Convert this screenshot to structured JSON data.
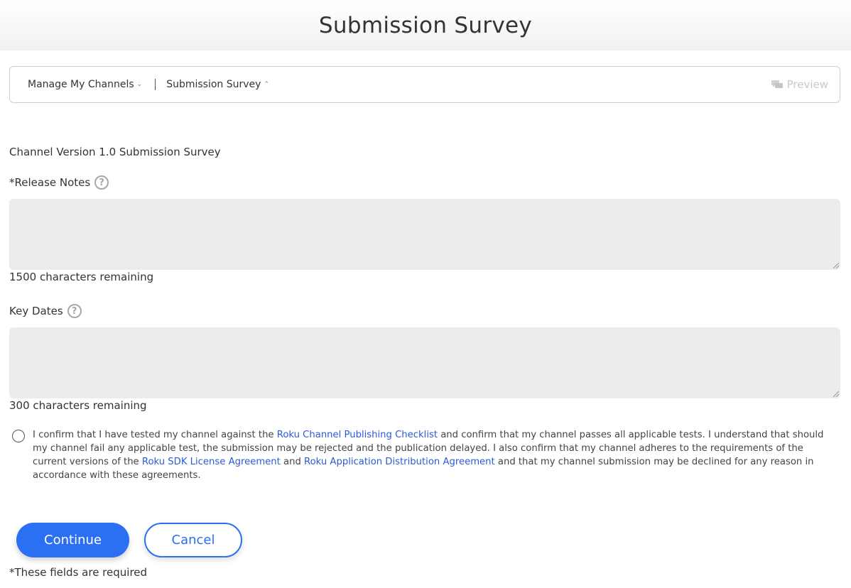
{
  "header": {
    "title": "Submission Survey"
  },
  "nav": {
    "crumbs": [
      {
        "label": "Manage My Channels"
      },
      {
        "label": "Submission Survey"
      }
    ],
    "preview_label": "Preview"
  },
  "form": {
    "section_title": "Channel Version 1.0 Submission Survey",
    "release_notes": {
      "label": "*Release Notes",
      "value": "",
      "remaining": "1500 characters remaining"
    },
    "key_dates": {
      "label": "Key Dates",
      "value": "",
      "remaining": "300 characters remaining"
    },
    "confirm": {
      "text1": "I confirm that I have tested my channel against the ",
      "link1": "Roku Channel Publishing Checklist",
      "text2": " and confirm that my channel passes all applicable tests. I understand that should my channel fail any applicable test, the submission may be rejected and the publication delayed. I also confirm that my channel adheres to the requirements of the current versions of the ",
      "link2": "Roku SDK License Agreement",
      "text3": " and ",
      "link3": "Roku Application Distribution Agreement",
      "text4": " and that my channel submission may be declined for any reason in accordance with these agreements."
    },
    "continue_label": "Continue",
    "cancel_label": "Cancel",
    "required_note": "*These fields are required"
  },
  "icons": {
    "help": "?",
    "chevron_down": "⌄",
    "chevron_up": "⌃"
  },
  "colors": {
    "accent": "#2b6ff3",
    "link": "#2a5bd7",
    "field_bg": "#ececec"
  }
}
